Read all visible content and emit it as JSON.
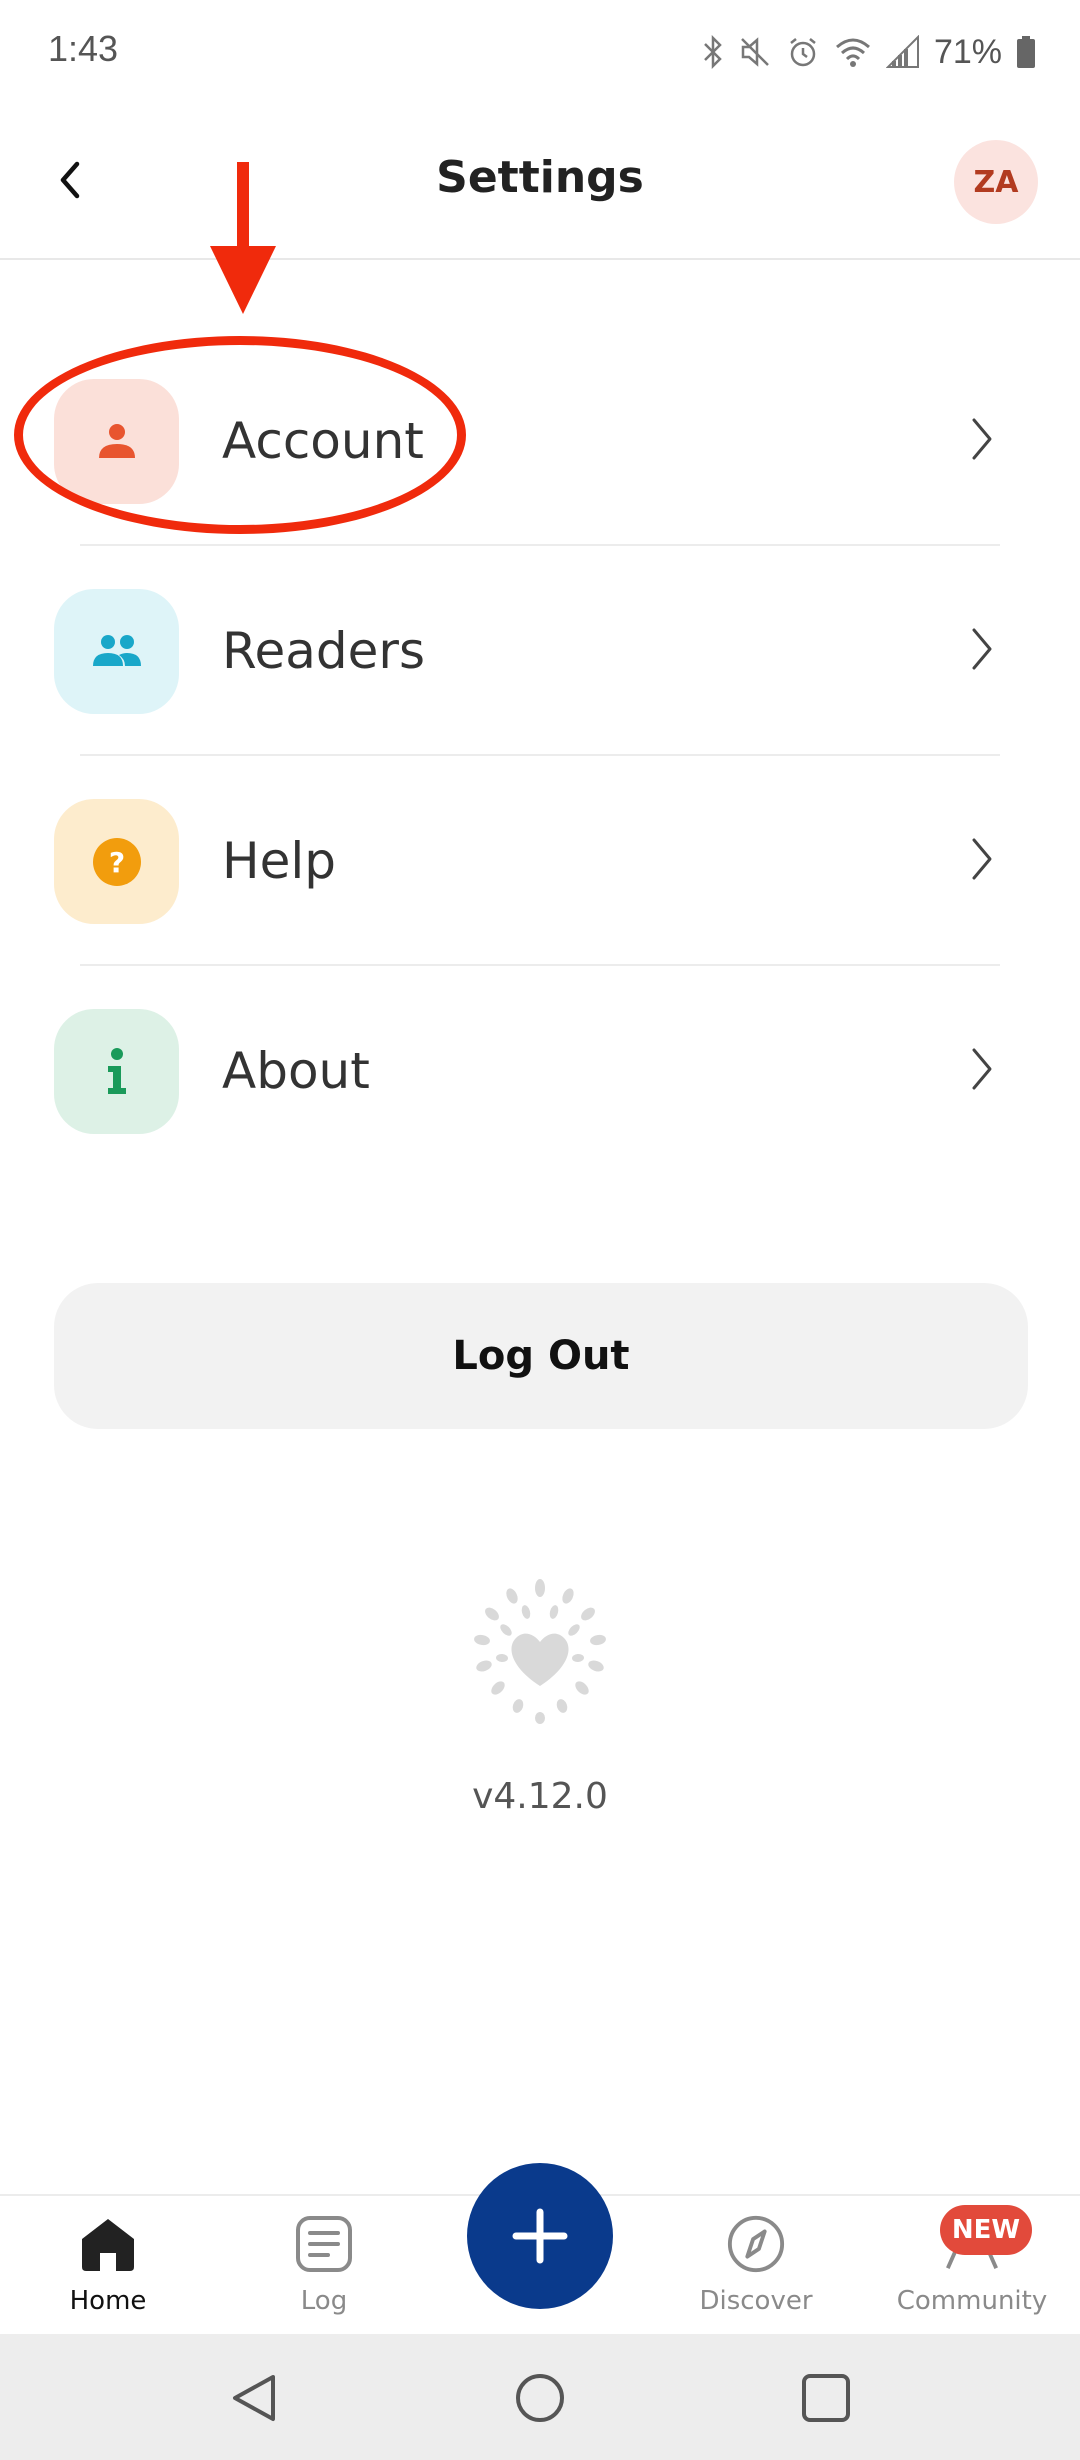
{
  "status_bar": {
    "time": "1:43",
    "battery": "71%"
  },
  "header": {
    "title": "Settings",
    "avatar_initials": "ZA"
  },
  "settings_items": [
    {
      "label": "Account",
      "icon": "person-icon",
      "icon_color": "#e8552f",
      "bg_color": "#fbe0d9"
    },
    {
      "label": "Readers",
      "icon": "people-icon",
      "icon_color": "#19a7c9",
      "bg_color": "#def4f8"
    },
    {
      "label": "Help",
      "icon": "question-icon",
      "icon_color": "#f29d0d",
      "bg_color": "#fdeccd"
    },
    {
      "label": "About",
      "icon": "info-icon",
      "icon_color": "#1a9a5a",
      "bg_color": "#ddf1e6"
    }
  ],
  "logout_label": "Log Out",
  "version": "v4.12.0",
  "bottom_nav": {
    "items": [
      {
        "label": "Home",
        "icon": "home-icon",
        "active": true
      },
      {
        "label": "Log",
        "icon": "log-icon",
        "active": false
      },
      {
        "label": "Discover",
        "icon": "compass-icon",
        "active": false
      },
      {
        "label": "Community",
        "icon": "community-icon",
        "active": false
      }
    ],
    "badge": "NEW",
    "fab_icon": "plus-icon"
  },
  "colors": {
    "annotation": "#f02a0c",
    "fab": "#0a3a8c",
    "badge": "#e24a3b"
  }
}
